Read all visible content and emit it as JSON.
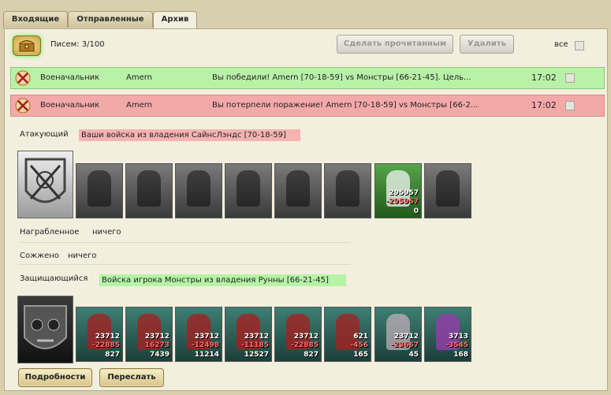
{
  "tabs": [
    {
      "label": "Входящие",
      "active": false
    },
    {
      "label": "Отправленные",
      "active": false
    },
    {
      "label": "Архив",
      "active": true
    }
  ],
  "toolbar": {
    "chest_icon": "treasure-chest-icon",
    "count_text": "Писем: 3/100",
    "mark_read_label": "Сделать прочитанным",
    "delete_label": "Удалить",
    "all_label": "все"
  },
  "messages": [
    {
      "sender": "Военачальник",
      "recipient": "Amern",
      "subject": "Вы победили! Amern [70-18-59] vs Монстры [66-21-45]. Цель...",
      "time": "17:02",
      "status_color": "#b9f1a9"
    },
    {
      "sender": "Военачальник",
      "recipient": "Amern",
      "subject": "Вы потерпели поражение! Amern [70-18-59] vs Монстры [66-2...",
      "time": "17:02",
      "status_color": "#f4a9a9"
    }
  ],
  "report": {
    "attacker_label": "Атакующий",
    "attacker_army": "Ваши войска из владения СайнсЛэндс [70-18-59]",
    "attacker_units": [
      {},
      {},
      {},
      {},
      {},
      {},
      {
        "n1": "295957",
        "n2": "-295957",
        "n3": "0"
      },
      {}
    ],
    "loot_label": "Награбленное",
    "loot_value": "ничего",
    "burned_label": "Сожжено",
    "burned_value": "ничего",
    "defender_label": "Защищающийся",
    "defender_army": "Войска игрока Монстры из владения Рунны [66-21-45]",
    "defender_units": [
      {
        "n1": "23712",
        "n2": "-22885",
        "n3": "827"
      },
      {
        "n1": "23712",
        "n2": "16273",
        "n3": "7439"
      },
      {
        "n1": "23712",
        "n2": "-12498",
        "n3": "11214"
      },
      {
        "n1": "23712",
        "n2": "-11185",
        "n3": "12527"
      },
      {
        "n1": "23712",
        "n2": "-22885",
        "n3": "827"
      },
      {
        "n1": "621",
        "n2": "-456",
        "n3": "165"
      },
      {
        "n1": "23712",
        "n2": "-23667",
        "n3": "45"
      },
      {
        "n1": "3713",
        "n2": "-3545",
        "n3": "168"
      }
    ]
  },
  "bottom": {
    "details_label": "Подробности",
    "forward_label": "Переслать"
  }
}
